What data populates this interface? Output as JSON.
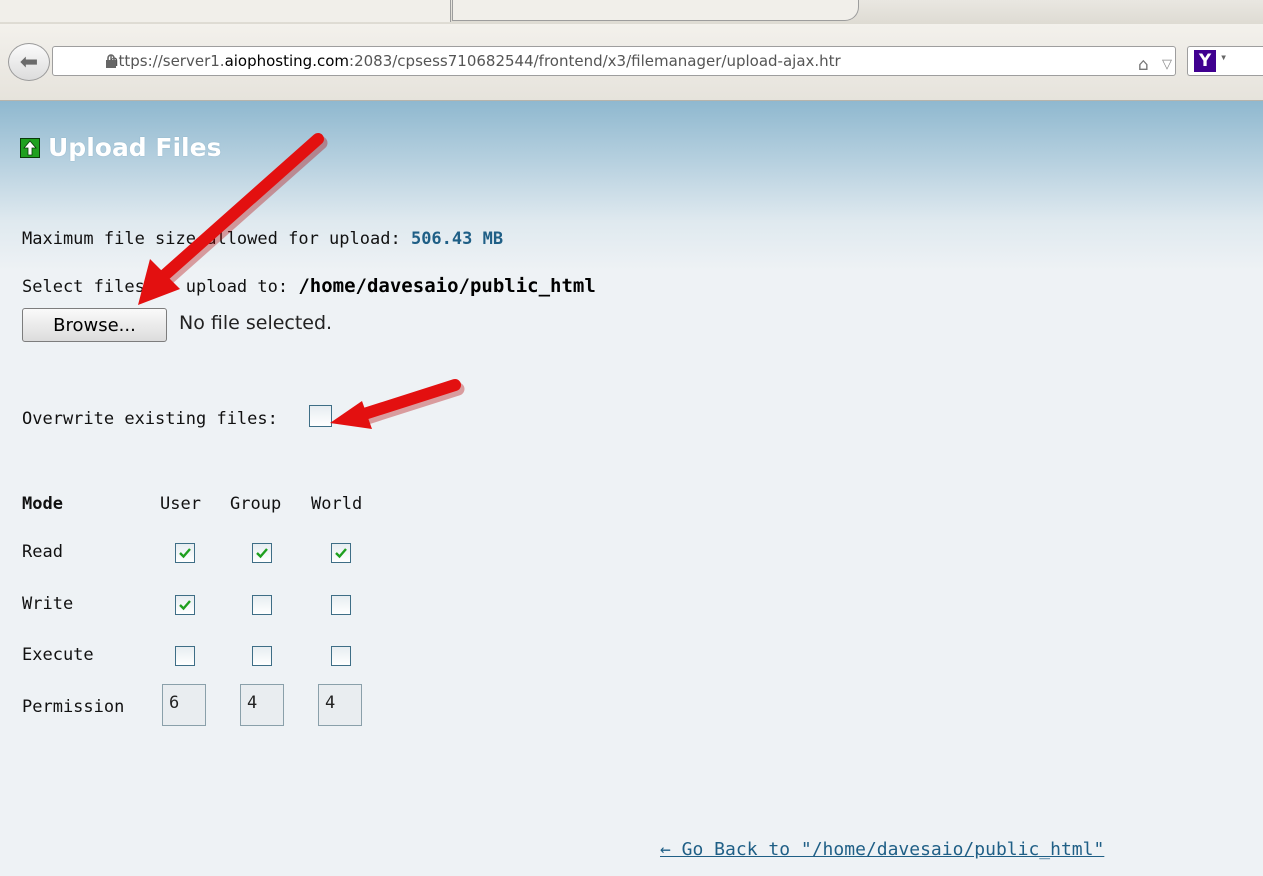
{
  "browser": {
    "url_prefix": "https://server1.",
    "url_domain": "aiophosting.com",
    "url_suffix": ":2083/cpsess710682544/frontend/x3/filemanager/upload-ajax.htr",
    "search_engine_letter": "Y"
  },
  "page": {
    "title": "Upload Files",
    "max_size_label": "Maximum file size allowed for upload:",
    "max_size_value": "506.43 MB",
    "select_label": "Select files to upload to:",
    "upload_path": "/home/davesaio/public_html",
    "browse_label": "Browse...",
    "file_status": "No file selected.",
    "overwrite_label": "Overwrite existing files:",
    "overwrite_checked": false,
    "go_back_link": "← Go Back to \"/home/davesaio/public_html\""
  },
  "permissions": {
    "headers": {
      "mode": "Mode",
      "user": "User",
      "group": "Group",
      "world": "World"
    },
    "rows": [
      {
        "label": "Read",
        "user": true,
        "group": true,
        "world": true
      },
      {
        "label": "Write",
        "user": true,
        "group": false,
        "world": false
      },
      {
        "label": "Execute",
        "user": false,
        "group": false,
        "world": false
      }
    ],
    "permission_label": "Permission",
    "values": {
      "user": "6",
      "group": "4",
      "world": "4"
    }
  },
  "colors": {
    "accent": "#1f5f86",
    "check": "#1fa01f",
    "arrow": "#e31010"
  }
}
